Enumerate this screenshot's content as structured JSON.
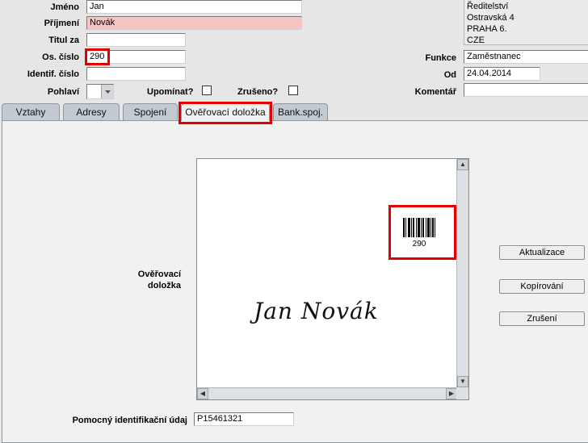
{
  "form": {
    "jmeno_label": "Jméno",
    "jmeno_value": "Jan",
    "prijmeni_label": "Příjmení",
    "prijmeni_value": "Novák",
    "titul_label": "Titul za",
    "titul_value": "",
    "os_cislo_label": "Os. číslo",
    "os_cislo_value": "290",
    "identif_label": "Identif. číslo",
    "identif_value": "",
    "pohlavi_label": "Pohlaví",
    "pohlavi_value": "",
    "upominat_label": "Upomínat?",
    "upominat_checked": false,
    "zruseno_label": "Zrušeno?",
    "zruseno_checked": false
  },
  "right": {
    "address_lines": [
      "Ředitelství",
      "Ostravská 4",
      "PRAHA 6.",
      "CZE"
    ],
    "funkce_label": "Funkce",
    "funkce_value": "Zaměstnanec",
    "od_label": "Od",
    "od_value": "24.04.2014",
    "komentar_label": "Komentář",
    "komentar_value": ""
  },
  "tabs": [
    {
      "label": "Vztahy"
    },
    {
      "label": "Adresy"
    },
    {
      "label": "Spojení"
    },
    {
      "label": "Ověřovací doložka",
      "active": true
    },
    {
      "label": "Bank.spoj."
    }
  ],
  "panel": {
    "section_label_line1": "Ověřovací",
    "section_label_line2": "doložka",
    "barcode_number": "290",
    "signature_text": "Jan Novák",
    "buttons": {
      "aktualizace": "Aktualizace",
      "kopirovani": "Kopírování",
      "zruseni": "Zrušení"
    },
    "pomocny_label": "Pomocný identifikační údaj",
    "pomocny_value": "P15461321"
  },
  "colors": {
    "highlight": "#e00000",
    "invalid_field": "#f7c4c4",
    "tab_bg": "#c3cad2",
    "panel_bg": "#f1f1f1"
  },
  "icons": [
    "chevron-down-icon",
    "scroll-up-icon",
    "scroll-down-icon",
    "scroll-left-icon",
    "scroll-right-icon"
  ]
}
